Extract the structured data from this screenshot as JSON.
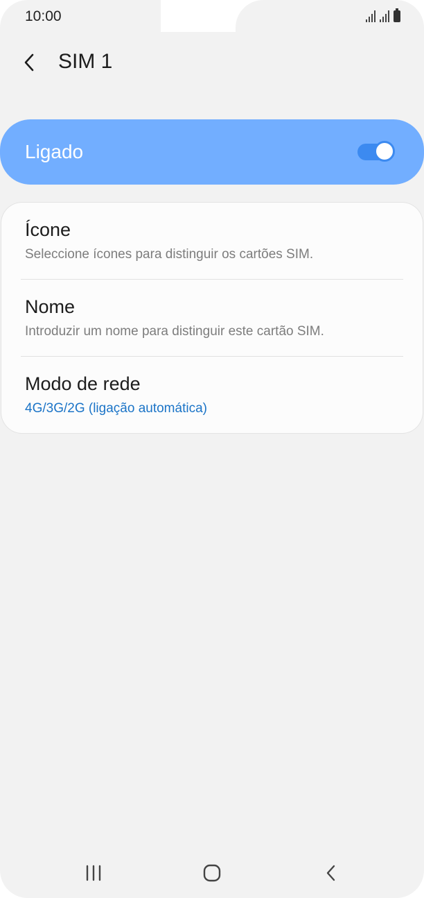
{
  "status_bar": {
    "time": "10:00",
    "icons": [
      "signal-icon",
      "signal-icon",
      "battery-icon"
    ]
  },
  "app_bar": {
    "title": "SIM 1",
    "back_icon": "chevron-left-icon"
  },
  "master_switch": {
    "label": "Ligado",
    "state": "on",
    "accent": "#72aeff",
    "toggle_color": "#3c8af0"
  },
  "settings": {
    "items": [
      {
        "title": "Ícone",
        "subtitle": "Seleccione ícones para distinguir os cartões SIM."
      },
      {
        "title": "Nome",
        "subtitle": "Introduzir um nome para distinguir este cartão SIM."
      },
      {
        "title": "Modo de rede",
        "subtitle": "4G/3G/2G (ligação automática)"
      }
    ],
    "accent_subtitle_color": "#1b74c7"
  },
  "nav_bar": {
    "icons": [
      "recents-icon",
      "home-icon",
      "back-icon"
    ]
  }
}
